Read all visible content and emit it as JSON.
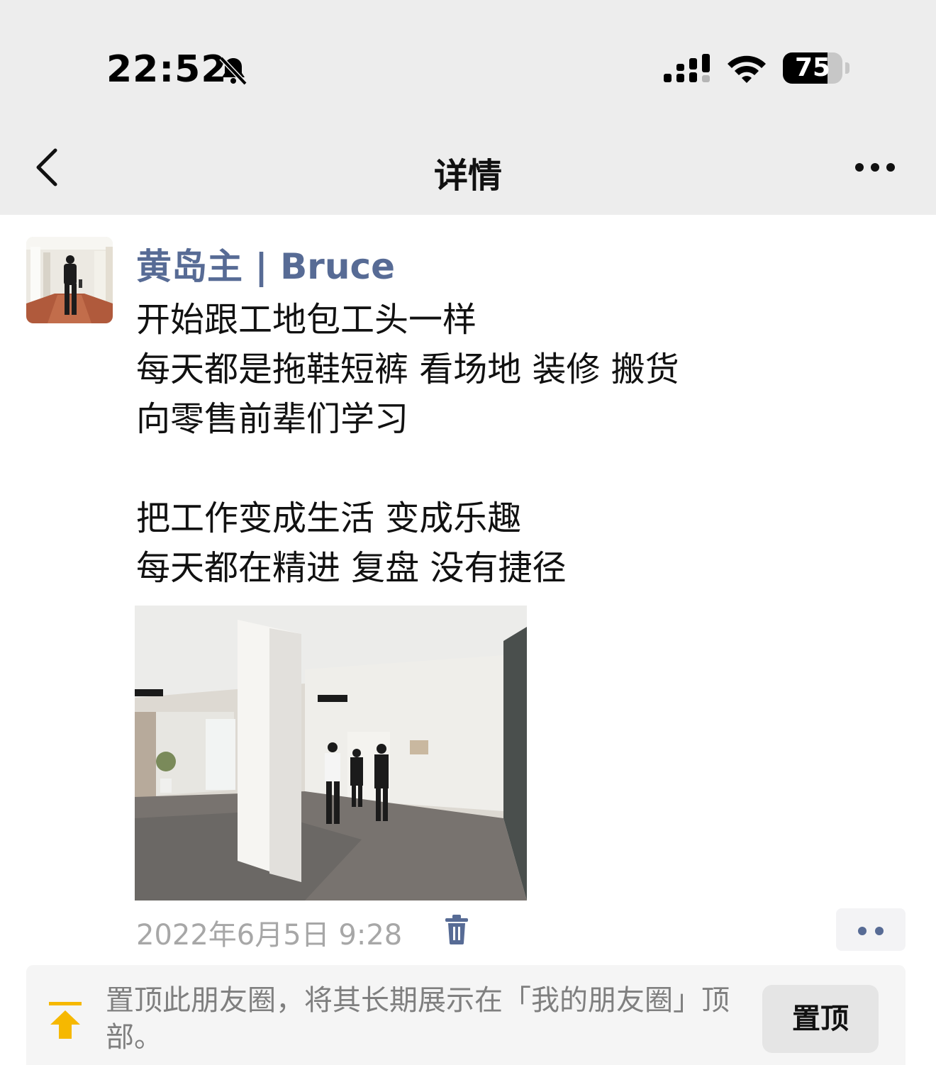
{
  "status_bar": {
    "time": "22:52",
    "battery_level": "75",
    "battery_fraction": 0.75
  },
  "nav": {
    "title": "详情"
  },
  "post": {
    "author": "黄岛主 | Bruce",
    "lines": [
      "开始跟工地包工头一样",
      "每天都是拖鞋短裤 看场地 装修 搬货",
      "向零售前辈们学习",
      "",
      "把工作变成生活 变成乐趣",
      "每天都在精进 复盘 没有捷径"
    ],
    "timestamp": "2022年6月5日 9:28"
  },
  "pin": {
    "message": "置顶此朋友圈，将其长期展示在「我的朋友圈」顶部。",
    "button_label": "置顶"
  },
  "colors": {
    "author_link": "#576b95",
    "pin_arrow": "#f6b800",
    "header_bg": "#ededed"
  },
  "icons": [
    "bell-off-icon",
    "signal-icon",
    "wifi-icon",
    "battery-icon",
    "back-icon",
    "more-icon",
    "trash-icon",
    "pin-top-icon"
  ]
}
